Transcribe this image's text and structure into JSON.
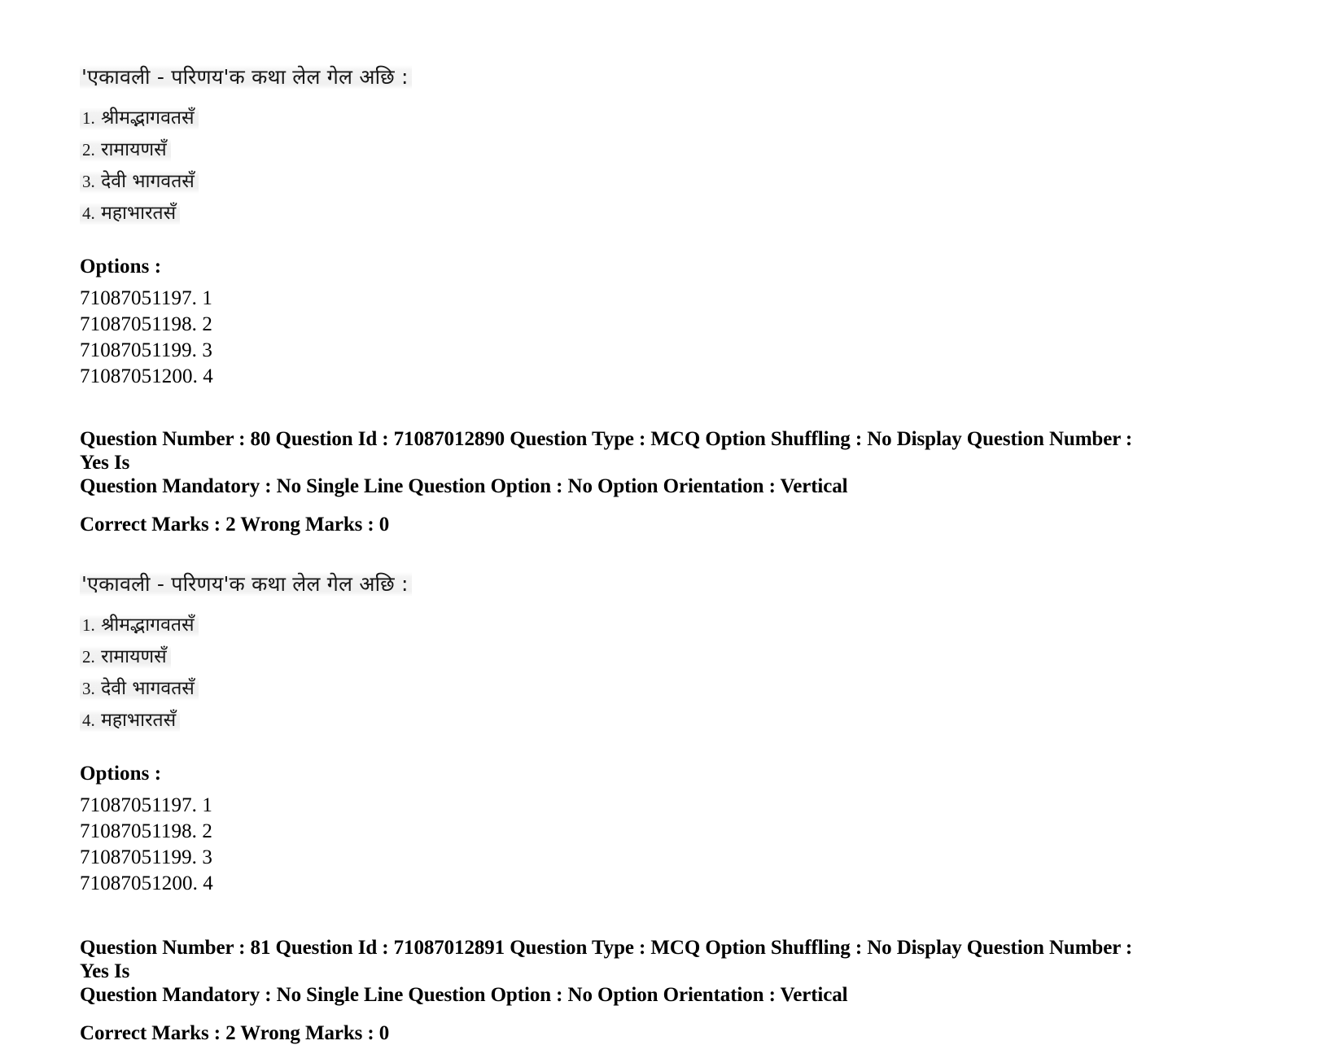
{
  "document": {
    "type": "exam-question-paper-page",
    "page_background": "#ffffff",
    "text_color": "#000000"
  },
  "question_blocks": [
    {
      "stem": "'एकावली - परिणय'क कथा लेल गेल अछि :",
      "choices": [
        {
          "number": "1.",
          "text": "श्रीमद्भागवतसँ"
        },
        {
          "number": "2.",
          "text": "रामायणसँ"
        },
        {
          "number": "3.",
          "text": "देवी भागवतसँ"
        },
        {
          "number": "4.",
          "text": "महाभारतसँ"
        }
      ],
      "options_heading": "Options :",
      "options": [
        "71087051197. 1",
        "71087051198. 2",
        "71087051199. 3",
        "71087051200. 4"
      ]
    },
    {
      "stem": "'एकावली - परिणय'क कथा लेल गेल अछि :",
      "choices": [
        {
          "number": "1.",
          "text": "श्रीमद्भागवतसँ"
        },
        {
          "number": "2.",
          "text": "रामायणसँ"
        },
        {
          "number": "3.",
          "text": "देवी भागवतसँ"
        },
        {
          "number": "4.",
          "text": "महाभारतसँ"
        }
      ],
      "options_heading": "Options :",
      "options": [
        "71087051197. 1",
        "71087051198. 2",
        "71087051199. 3",
        "71087051200. 4"
      ]
    }
  ],
  "metadata_blocks": [
    {
      "line1": "Question Number : 80 Question Id : 71087012890 Question Type : MCQ Option Shuffling : No Display Question Number : Yes Is",
      "line2": "Question Mandatory : No Single Line Question Option : No Option Orientation : Vertical",
      "marks": "Correct Marks : 2 Wrong Marks : 0"
    },
    {
      "line1": "Question Number : 81 Question Id : 71087012891 Question Type : MCQ Option Shuffling : No Display Question Number : Yes Is",
      "line2": "Question Mandatory : No Single Line Question Option : No Option Orientation : Vertical",
      "marks": "Correct Marks : 2 Wrong Marks : 0"
    }
  ]
}
